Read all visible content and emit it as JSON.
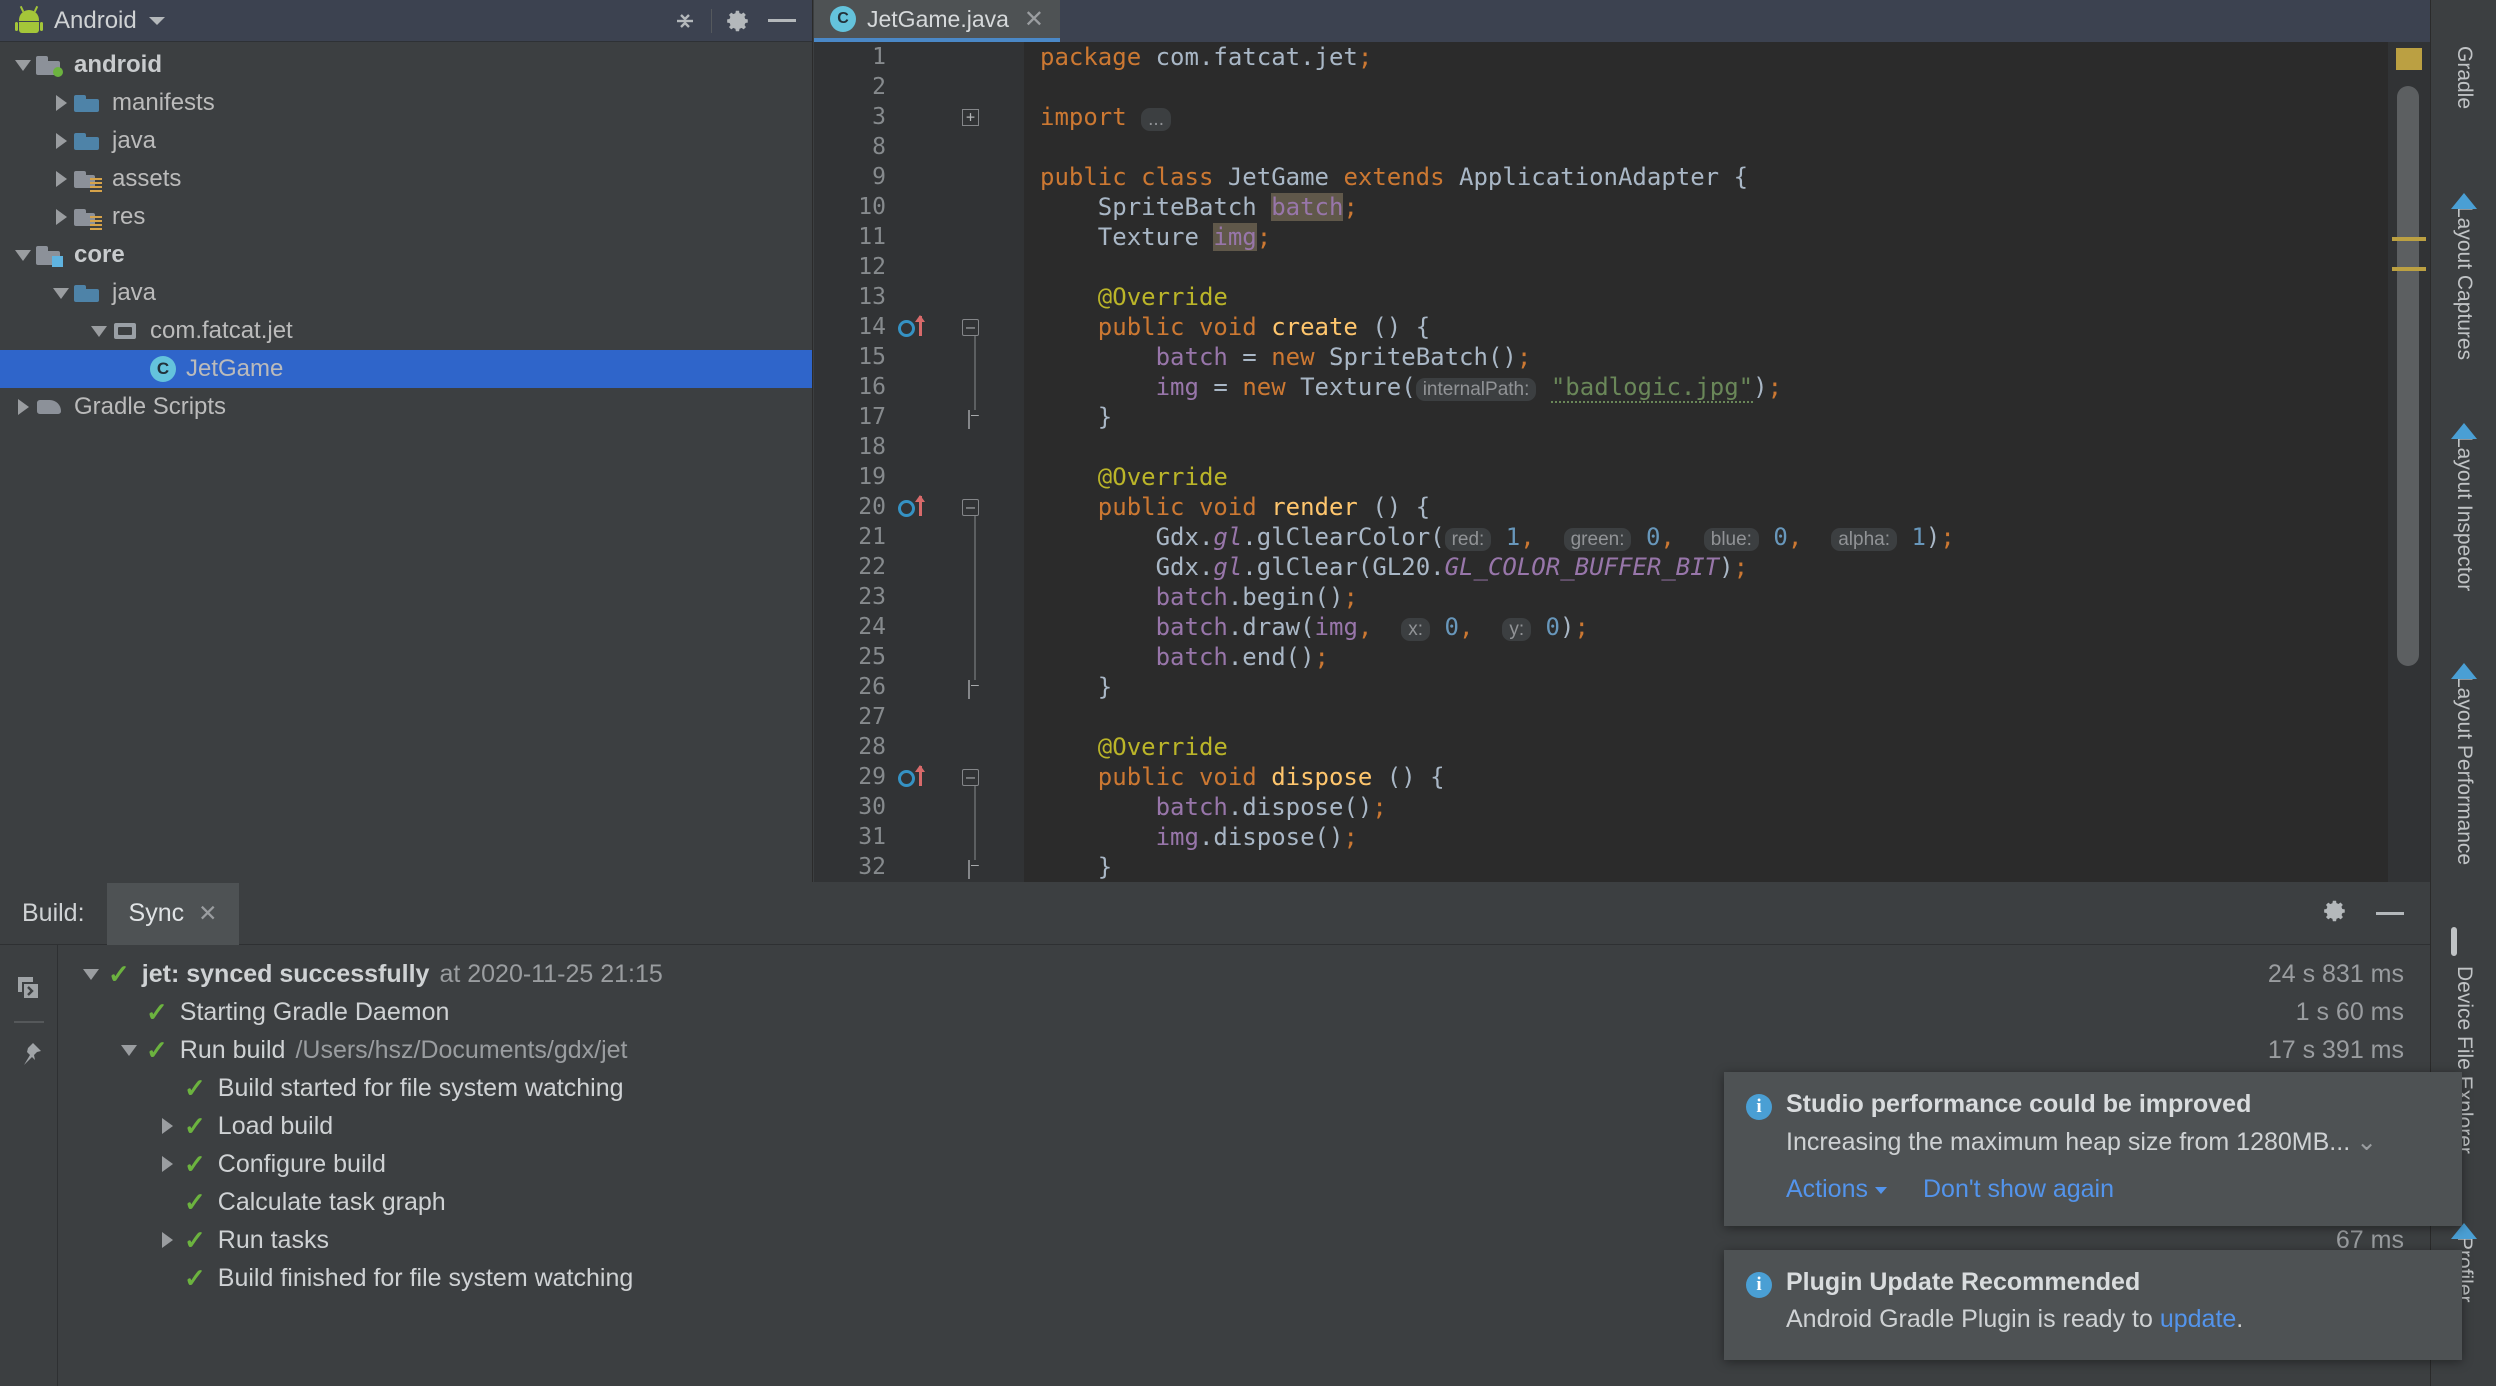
{
  "project_panel": {
    "header": {
      "title": "Android",
      "logo_icon": "android-logo-icon",
      "dropdown_icon": "chevron-down-icon",
      "collapse_all_icon": "collapse-all-icon",
      "settings_icon": "gear-icon",
      "hide_icon": "minimize-icon"
    },
    "tree": [
      {
        "label": "android",
        "depth": 0,
        "twisty": "open",
        "icon": "module-folder-green-icon",
        "bold": true,
        "selected": false
      },
      {
        "label": "manifests",
        "depth": 1,
        "twisty": "closed",
        "icon": "folder-blue-icon",
        "bold": false,
        "selected": false
      },
      {
        "label": "java",
        "depth": 1,
        "twisty": "closed",
        "icon": "folder-blue-icon",
        "bold": false,
        "selected": false
      },
      {
        "label": "assets",
        "depth": 1,
        "twisty": "closed",
        "icon": "folder-resource-icon",
        "bold": false,
        "selected": false
      },
      {
        "label": "res",
        "depth": 1,
        "twisty": "closed",
        "icon": "folder-resource-icon",
        "bold": false,
        "selected": false
      },
      {
        "label": "core",
        "depth": 0,
        "twisty": "open",
        "icon": "module-folder-blue-icon",
        "bold": true,
        "selected": false
      },
      {
        "label": "java",
        "depth": 1,
        "twisty": "open",
        "icon": "folder-blue-icon",
        "bold": false,
        "selected": false
      },
      {
        "label": "com.fatcat.jet",
        "depth": 2,
        "twisty": "open",
        "icon": "package-icon",
        "bold": false,
        "selected": false
      },
      {
        "label": "JetGame",
        "depth": 3,
        "twisty": "none",
        "icon": "java-class-icon",
        "bold": false,
        "selected": true
      },
      {
        "label": "Gradle Scripts",
        "depth": 0,
        "twisty": "closed",
        "icon": "gradle-elephant-icon",
        "bold": false,
        "selected": false
      }
    ]
  },
  "editor": {
    "tab": {
      "label": "JetGame.java",
      "icon": "java-class-icon",
      "badge": "C",
      "close_icon": "close-icon"
    },
    "lines": [
      {
        "num": "1",
        "gutter": "",
        "fold": "",
        "tokens": [
          {
            "t": "package ",
            "c": "kw"
          },
          {
            "t": "com.fatcat.jet",
            "c": "plain"
          },
          {
            "t": ";",
            "c": "semi"
          }
        ]
      },
      {
        "num": "2",
        "gutter": "",
        "fold": "",
        "tokens": []
      },
      {
        "num": "3",
        "gutter": "",
        "fold": "plus",
        "tokens": [
          {
            "t": "import ",
            "c": "kw"
          },
          {
            "t": "...",
            "c": "folded"
          }
        ]
      },
      {
        "num": "8",
        "gutter": "",
        "fold": "",
        "tokens": []
      },
      {
        "num": "9",
        "gutter": "",
        "fold": "",
        "tokens": [
          {
            "t": "public class ",
            "c": "kw"
          },
          {
            "t": "JetGame ",
            "c": "plain"
          },
          {
            "t": "extends ",
            "c": "kw"
          },
          {
            "t": "ApplicationAdapter ",
            "c": "plain"
          },
          {
            "t": "{",
            "c": "plain"
          }
        ]
      },
      {
        "num": "10",
        "gutter": "",
        "fold": "",
        "tokens": [
          {
            "t": "    SpriteBatch ",
            "c": "plain"
          },
          {
            "t": "batch",
            "c": "fieldhl"
          },
          {
            "t": ";",
            "c": "semi"
          }
        ]
      },
      {
        "num": "11",
        "gutter": "",
        "fold": "",
        "tokens": [
          {
            "t": "    Texture ",
            "c": "plain"
          },
          {
            "t": "img",
            "c": "fieldhl"
          },
          {
            "t": ";",
            "c": "semi"
          }
        ]
      },
      {
        "num": "12",
        "gutter": "",
        "fold": "",
        "tokens": []
      },
      {
        "num": "13",
        "gutter": "",
        "fold": "",
        "tokens": [
          {
            "t": "    @Override",
            "c": "ann"
          }
        ]
      },
      {
        "num": "14",
        "gutter": "override",
        "fold": "minus",
        "tokens": [
          {
            "t": "    public void ",
            "c": "kw"
          },
          {
            "t": "create ",
            "c": "def"
          },
          {
            "t": "() {",
            "c": "plain"
          }
        ]
      },
      {
        "num": "15",
        "gutter": "",
        "fold": "",
        "tokens": [
          {
            "t": "        ",
            "c": "plain"
          },
          {
            "t": "batch",
            "c": "field"
          },
          {
            "t": " = ",
            "c": "plain"
          },
          {
            "t": "new ",
            "c": "kw"
          },
          {
            "t": "SpriteBatch()",
            "c": "plain"
          },
          {
            "t": ";",
            "c": "semi"
          }
        ]
      },
      {
        "num": "16",
        "gutter": "",
        "fold": "",
        "tokens": [
          {
            "t": "        ",
            "c": "plain"
          },
          {
            "t": "img",
            "c": "field"
          },
          {
            "t": " = ",
            "c": "plain"
          },
          {
            "t": "new ",
            "c": "kw"
          },
          {
            "t": "Texture(",
            "c": "plain"
          },
          {
            "t": "internalPath:",
            "c": "hint"
          },
          {
            "t": " ",
            "c": "plain"
          },
          {
            "t": "\"badlogic.jpg\"",
            "c": "strw"
          },
          {
            "t": ")",
            "c": "plain"
          },
          {
            "t": ";",
            "c": "semi"
          }
        ]
      },
      {
        "num": "17",
        "gutter": "",
        "fold": "brace",
        "tokens": [
          {
            "t": "    }",
            "c": "plain"
          }
        ]
      },
      {
        "num": "18",
        "gutter": "",
        "fold": "",
        "tokens": []
      },
      {
        "num": "19",
        "gutter": "",
        "fold": "",
        "tokens": [
          {
            "t": "    @Override",
            "c": "ann"
          }
        ]
      },
      {
        "num": "20",
        "gutter": "override",
        "fold": "minus",
        "tokens": [
          {
            "t": "    public void ",
            "c": "kw"
          },
          {
            "t": "render ",
            "c": "def"
          },
          {
            "t": "() {",
            "c": "plain"
          }
        ]
      },
      {
        "num": "21",
        "gutter": "",
        "fold": "",
        "tokens": [
          {
            "t": "        Gdx.",
            "c": "plain"
          },
          {
            "t": "gl",
            "c": "statk"
          },
          {
            "t": ".glClearColor(",
            "c": "plain"
          },
          {
            "t": "red:",
            "c": "hint"
          },
          {
            "t": " ",
            "c": "plain"
          },
          {
            "t": "1",
            "c": "num2"
          },
          {
            "t": ",",
            "c": "semi"
          },
          {
            "t": "  ",
            "c": "plain"
          },
          {
            "t": "green:",
            "c": "hint"
          },
          {
            "t": " ",
            "c": "plain"
          },
          {
            "t": "0",
            "c": "num2"
          },
          {
            "t": ",",
            "c": "semi"
          },
          {
            "t": "  ",
            "c": "plain"
          },
          {
            "t": "blue:",
            "c": "hint"
          },
          {
            "t": " ",
            "c": "plain"
          },
          {
            "t": "0",
            "c": "num2"
          },
          {
            "t": ",",
            "c": "semi"
          },
          {
            "t": "  ",
            "c": "plain"
          },
          {
            "t": "alpha:",
            "c": "hint"
          },
          {
            "t": " ",
            "c": "plain"
          },
          {
            "t": "1",
            "c": "num2"
          },
          {
            "t": ")",
            "c": "plain"
          },
          {
            "t": ";",
            "c": "semi"
          }
        ]
      },
      {
        "num": "22",
        "gutter": "",
        "fold": "",
        "tokens": [
          {
            "t": "        Gdx.",
            "c": "plain"
          },
          {
            "t": "gl",
            "c": "statk"
          },
          {
            "t": ".glClear(GL20.",
            "c": "plain"
          },
          {
            "t": "GL_COLOR_BUFFER_BIT",
            "c": "stat"
          },
          {
            "t": ")",
            "c": "plain"
          },
          {
            "t": ";",
            "c": "semi"
          }
        ]
      },
      {
        "num": "23",
        "gutter": "",
        "fold": "",
        "tokens": [
          {
            "t": "        ",
            "c": "plain"
          },
          {
            "t": "batch",
            "c": "field"
          },
          {
            "t": ".begin()",
            "c": "plain"
          },
          {
            "t": ";",
            "c": "semi"
          }
        ]
      },
      {
        "num": "24",
        "gutter": "",
        "fold": "",
        "tokens": [
          {
            "t": "        ",
            "c": "plain"
          },
          {
            "t": "batch",
            "c": "field"
          },
          {
            "t": ".draw(",
            "c": "plain"
          },
          {
            "t": "img",
            "c": "field"
          },
          {
            "t": ",",
            "c": "semi"
          },
          {
            "t": "  ",
            "c": "plain"
          },
          {
            "t": "x:",
            "c": "hint"
          },
          {
            "t": " ",
            "c": "plain"
          },
          {
            "t": "0",
            "c": "num2"
          },
          {
            "t": ",",
            "c": "semi"
          },
          {
            "t": "  ",
            "c": "plain"
          },
          {
            "t": "y:",
            "c": "hint"
          },
          {
            "t": " ",
            "c": "plain"
          },
          {
            "t": "0",
            "c": "num2"
          },
          {
            "t": ")",
            "c": "plain"
          },
          {
            "t": ";",
            "c": "semi"
          }
        ]
      },
      {
        "num": "25",
        "gutter": "",
        "fold": "",
        "tokens": [
          {
            "t": "        ",
            "c": "plain"
          },
          {
            "t": "batch",
            "c": "field"
          },
          {
            "t": ".end()",
            "c": "plain"
          },
          {
            "t": ";",
            "c": "semi"
          }
        ]
      },
      {
        "num": "26",
        "gutter": "",
        "fold": "brace",
        "tokens": [
          {
            "t": "    }",
            "c": "plain"
          }
        ]
      },
      {
        "num": "27",
        "gutter": "",
        "fold": "",
        "tokens": []
      },
      {
        "num": "28",
        "gutter": "",
        "fold": "",
        "tokens": [
          {
            "t": "    @Override",
            "c": "ann"
          }
        ]
      },
      {
        "num": "29",
        "gutter": "override",
        "fold": "minus",
        "tokens": [
          {
            "t": "    public void ",
            "c": "kw"
          },
          {
            "t": "dispose ",
            "c": "def"
          },
          {
            "t": "() {",
            "c": "plain"
          }
        ]
      },
      {
        "num": "30",
        "gutter": "",
        "fold": "",
        "tokens": [
          {
            "t": "        ",
            "c": "plain"
          },
          {
            "t": "batch",
            "c": "field"
          },
          {
            "t": ".dispose()",
            "c": "plain"
          },
          {
            "t": ";",
            "c": "semi"
          }
        ]
      },
      {
        "num": "31",
        "gutter": "",
        "fold": "",
        "tokens": [
          {
            "t": "        ",
            "c": "plain"
          },
          {
            "t": "img",
            "c": "field"
          },
          {
            "t": ".dispose()",
            "c": "plain"
          },
          {
            "t": ";",
            "c": "semi"
          }
        ]
      },
      {
        "num": "32",
        "gutter": "",
        "fold": "brace",
        "tokens": [
          {
            "t": "    }",
            "c": "plain"
          }
        ]
      }
    ]
  },
  "right_sidebar": {
    "items": [
      {
        "label": "Gradle",
        "icon": "gradle-elephant-icon"
      },
      {
        "label": "Layout Captures",
        "icon": "layout-captures-icon"
      },
      {
        "label": "Layout Inspector",
        "icon": "layout-inspector-icon"
      },
      {
        "label": "Layout Performance",
        "icon": "layout-performance-icon"
      },
      {
        "label": "Device File Explorer",
        "icon": "device-explorer-icon"
      },
      {
        "label": "Profiler",
        "icon": "profiler-icon"
      }
    ]
  },
  "build_panel": {
    "label": "Build:",
    "tab": {
      "label": "Sync",
      "close_icon": "close-icon"
    },
    "settings_icon": "gear-icon",
    "hide_icon": "minimize-icon",
    "gutter_icons": [
      "copy-icon",
      "pin-icon"
    ],
    "tree": [
      {
        "depth": 0,
        "twisty": "open",
        "label": "jet: synced successfully",
        "bold": true,
        "suffix": "at 2020-11-25 21:15",
        "timing": "24 s 831 ms"
      },
      {
        "depth": 1,
        "twisty": "none",
        "label": "Starting Gradle Daemon",
        "bold": false,
        "suffix": "",
        "timing": "1 s 60 ms"
      },
      {
        "depth": 1,
        "twisty": "open",
        "label": "Run build",
        "bold": false,
        "suffix": "/Users/hsz/Documents/gdx/jet",
        "timing": "17 s 391 ms"
      },
      {
        "depth": 2,
        "twisty": "none",
        "label": "Build started for file system watching",
        "bold": false,
        "suffix": "",
        "timing": ""
      },
      {
        "depth": 2,
        "twisty": "closed",
        "label": "Load build",
        "bold": false,
        "suffix": "",
        "timing": ""
      },
      {
        "depth": 2,
        "twisty": "closed",
        "label": "Configure build",
        "bold": false,
        "suffix": "",
        "timing": ""
      },
      {
        "depth": 2,
        "twisty": "none",
        "label": "Calculate task graph",
        "bold": false,
        "suffix": "",
        "timing": ""
      },
      {
        "depth": 2,
        "twisty": "closed",
        "label": "Run tasks",
        "bold": false,
        "suffix": "",
        "timing": "67 ms"
      },
      {
        "depth": 2,
        "twisty": "none",
        "label": "Build finished for file system watching",
        "bold": false,
        "suffix": "",
        "timing": ""
      }
    ]
  },
  "notifications": [
    {
      "icon": "info-icon",
      "title": "Studio performance could be improved",
      "body": "Increasing the maximum heap size from 1280MB...",
      "expand_icon": "chevron-down-icon",
      "action_label": "Actions",
      "dismiss_label": "Don't show again"
    },
    {
      "icon": "info-icon",
      "title": "Plugin Update Recommended",
      "body_prefix": "Android Gradle Plugin is ready to ",
      "body_link": "update",
      "body_suffix": "."
    }
  ],
  "colors": {
    "accent_blue": "#4a88c7",
    "selection_blue": "#2f65ca",
    "success_green": "#6cb33f",
    "link_blue": "#5394ec",
    "editor_bg": "#2b2b2b",
    "panel_bg": "#3c3f41"
  }
}
